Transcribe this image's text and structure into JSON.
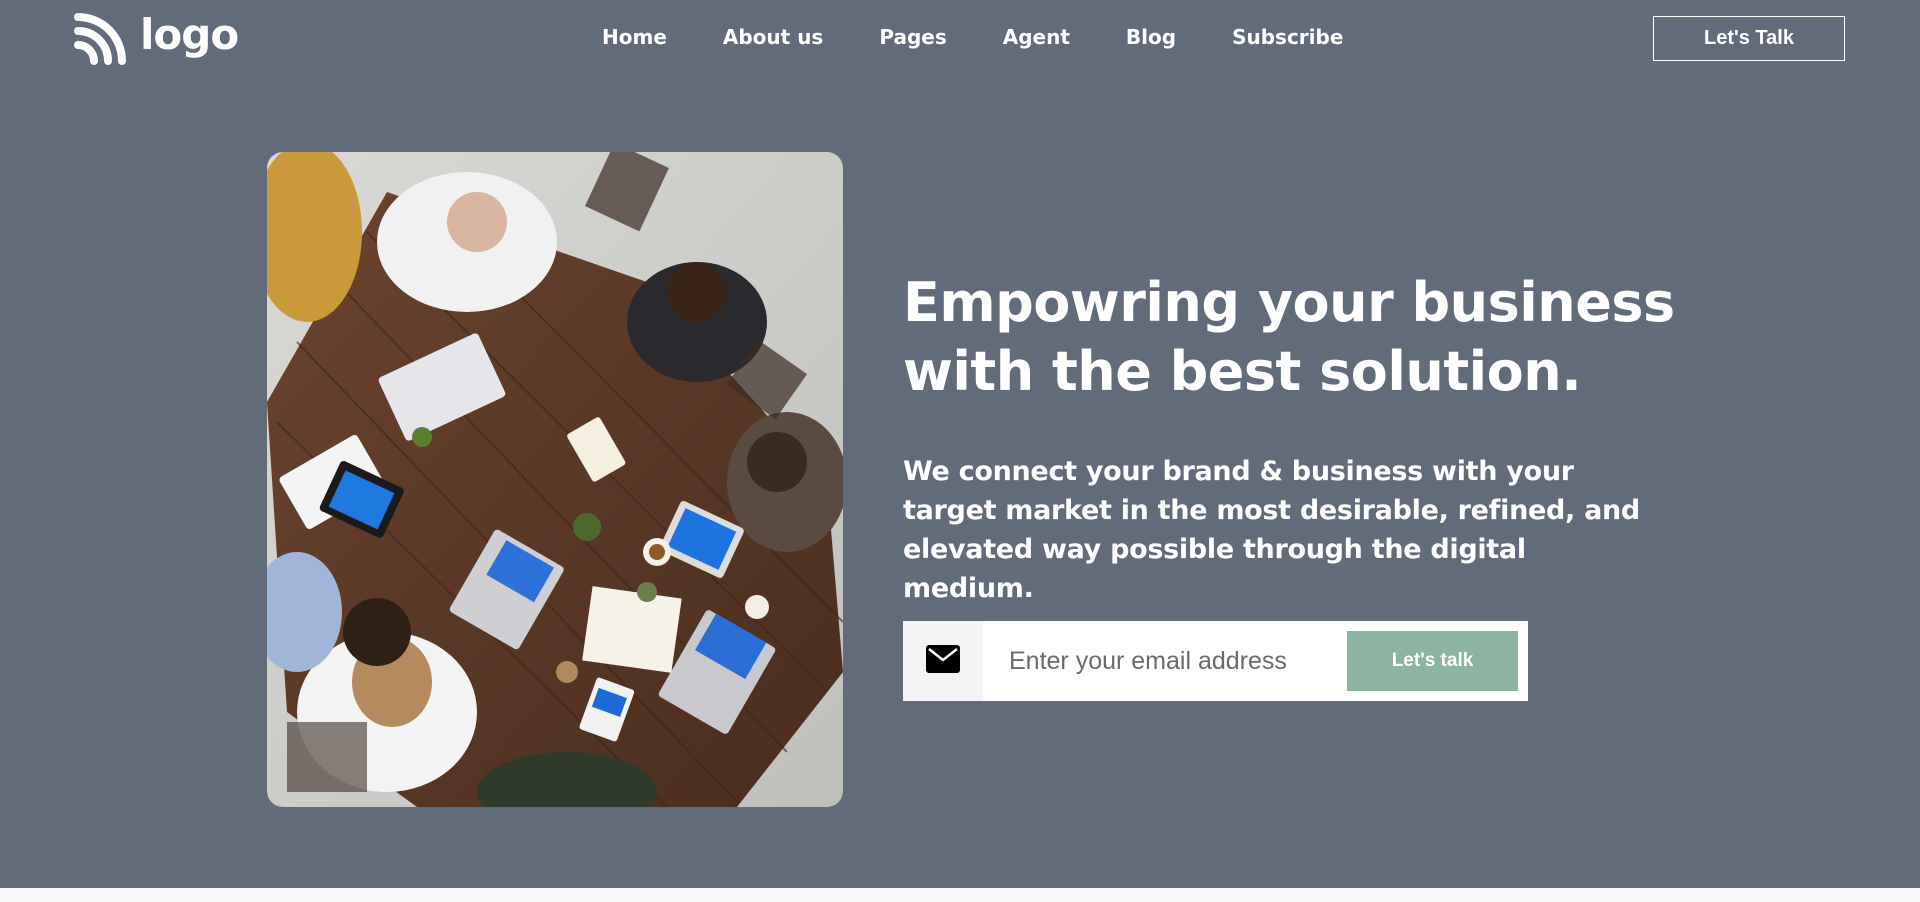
{
  "header": {
    "logo_text": "logo",
    "logo_icon": "wifi-arcs-icon",
    "nav": [
      {
        "label": "Home"
      },
      {
        "label": "About us"
      },
      {
        "label": "Pages"
      },
      {
        "label": "Agent"
      },
      {
        "label": "Blog"
      },
      {
        "label": "Subscribe"
      }
    ],
    "cta_label": "Let's Talk"
  },
  "hero": {
    "image_alt": "team-meeting-photo",
    "title_line1": "Empowring your business",
    "title_line2": "with the best solution.",
    "subtitle": "We connect your brand & business with your target market in the most desirable, refined, and elevated way possible through the digital medium.",
    "email_icon": "envelope-icon",
    "email_placeholder": "Enter your email address",
    "email_value": "",
    "submit_label": "Let's talk"
  },
  "colors": {
    "background": "#626b7a",
    "accent_button": "#8bb5a1",
    "text": "#ffffff"
  }
}
